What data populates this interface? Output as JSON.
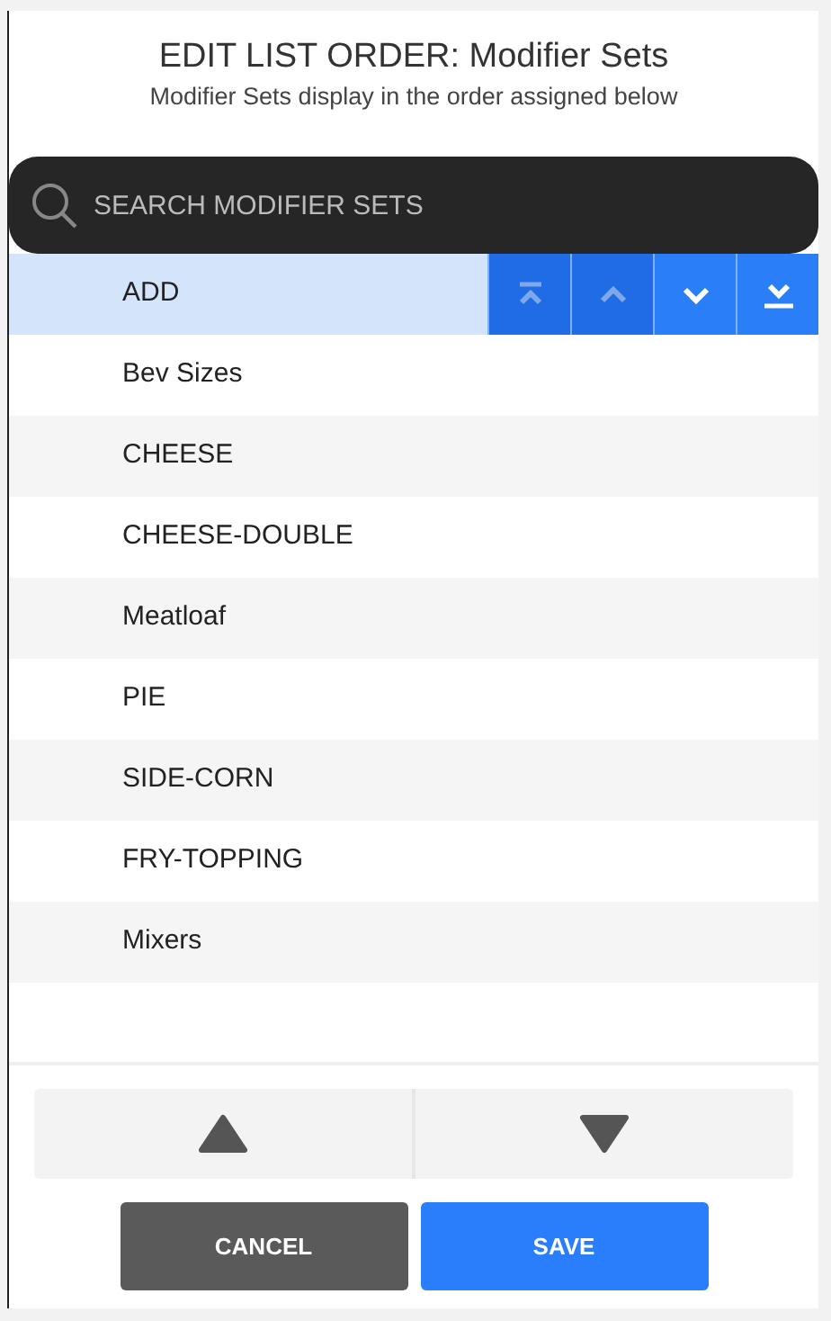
{
  "title": "EDIT LIST ORDER: Modifier Sets",
  "subtitle": "Modifier Sets display in the order assigned below",
  "search": {
    "placeholder": "SEARCH MODIFIER SETS"
  },
  "items": [
    {
      "label": "ADD",
      "selected": true
    },
    {
      "label": "Bev Sizes",
      "selected": false
    },
    {
      "label": "CHEESE",
      "selected": false
    },
    {
      "label": "CHEESE-DOUBLE",
      "selected": false
    },
    {
      "label": "Meatloaf",
      "selected": false
    },
    {
      "label": "PIE",
      "selected": false
    },
    {
      "label": "SIDE-CORN",
      "selected": false
    },
    {
      "label": "FRY-TOPPING",
      "selected": false
    },
    {
      "label": "Mixers",
      "selected": false
    }
  ],
  "row_actions": [
    {
      "kind": "top",
      "disabled": true
    },
    {
      "kind": "up",
      "disabled": true
    },
    {
      "kind": "down",
      "disabled": false
    },
    {
      "kind": "bottom",
      "disabled": false
    }
  ],
  "move_buttons": [
    {
      "kind": "up"
    },
    {
      "kind": "down"
    }
  ],
  "buttons": [
    {
      "kind": "cancel",
      "label": "CANCEL"
    },
    {
      "kind": "save",
      "label": "SAVE"
    }
  ]
}
